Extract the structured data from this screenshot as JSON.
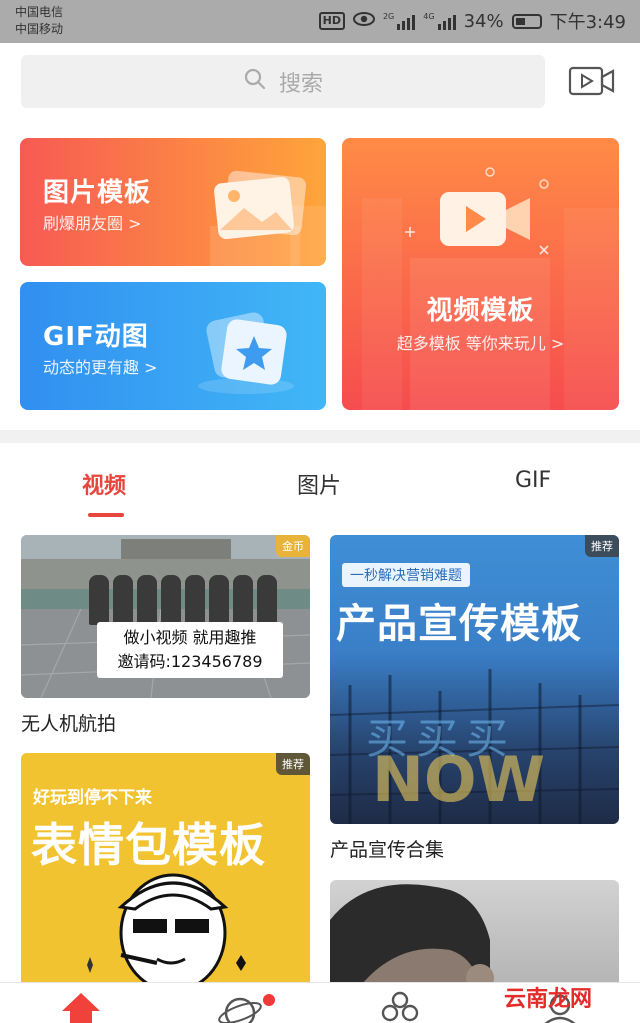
{
  "status_bar": {
    "carrier1": "中国电信",
    "carrier2": "中国移动",
    "hd": "HD",
    "network1": "2G",
    "network2": "4G",
    "battery": "34%",
    "time": "下午3:49"
  },
  "search": {
    "placeholder": "搜索",
    "icon": "search-icon",
    "video_icon": "video-camera-icon"
  },
  "templates": {
    "photo": {
      "title": "图片模板",
      "subtitle": "刷爆朋友圈 >",
      "color_start": "#f75a53",
      "color_end": "#ffa53a"
    },
    "gif": {
      "title": "GIF动图",
      "subtitle": "动态的更有趣 >",
      "color_start": "#318ff0",
      "color_end": "#41b7f7"
    },
    "video": {
      "title": "视频模板",
      "subtitle": "超多模板 等你来玩儿 >",
      "color_start": "#ff8b46",
      "color_end": "#f64d4e"
    }
  },
  "tabs": [
    {
      "label": "视频",
      "active": true
    },
    {
      "label": "图片",
      "active": false
    },
    {
      "label": "GIF",
      "active": false
    }
  ],
  "accent": "#e8453c",
  "feed": [
    {
      "badge": "金币",
      "overlay_line1": "做小视频 就用趣推",
      "overlay_line2": "邀请码:123456789",
      "caption": "无人机航拍"
    },
    {
      "badge": "推荐",
      "tag": "一秒解决营销难题",
      "headline": "产品宣传模板",
      "neon1": "买买买",
      "neon2": "NOW",
      "caption": "产品宣传合集"
    },
    {
      "badge": "推荐",
      "tagline": "好玩到停不下来",
      "headline": "表情包模板"
    },
    {
      "badge": ""
    }
  ],
  "bottom_nav": {
    "icons": [
      "home-icon",
      "planet-icon",
      "community-icon",
      "profile-icon"
    ]
  },
  "watermark": "云南龙网"
}
